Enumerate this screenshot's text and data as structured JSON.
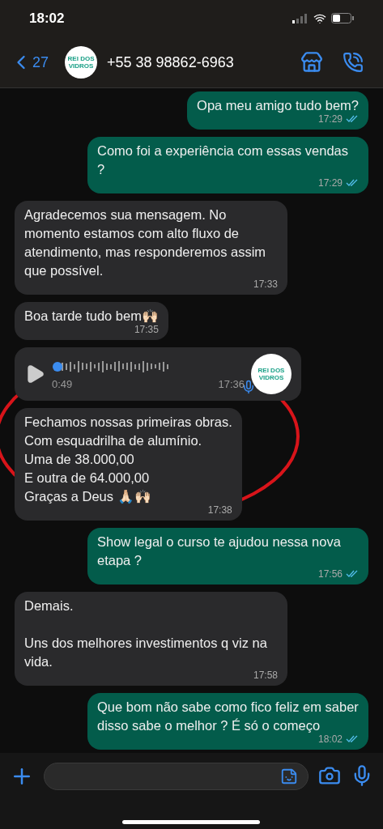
{
  "status_bar": {
    "time": "18:02"
  },
  "header": {
    "back_count": "27",
    "avatar_text": "REI DOS VIDROS",
    "title": "+55 38 98862-6963"
  },
  "messages": [
    {
      "kind": "text",
      "outgoing": true,
      "text": "Opa meu amigo tudo bem?",
      "time": "17:29",
      "read": true
    },
    {
      "kind": "text",
      "outgoing": true,
      "text": "Como foi a experiência com essas vendas ?",
      "time": "17:29",
      "read": true
    },
    {
      "kind": "text",
      "outgoing": false,
      "text": "Agradecemos sua mensagem. No momento estamos com alto fluxo de atendimento, mas responderemos assim que possível.",
      "time": "17:33"
    },
    {
      "kind": "text",
      "outgoing": false,
      "text": "Boa tarde tudo bem🙌🏻",
      "time": "17:35"
    },
    {
      "kind": "voice",
      "outgoing": false,
      "duration": "0:49",
      "time": "17:36",
      "avatar_text": "REI DOS VIDROS",
      "level": 0
    },
    {
      "kind": "text",
      "outgoing": false,
      "text": "Fechamos nossas primeiras obras.\nCom esquadrilha de alumínio.\nUma de 38.000,00\nE outra de 64.000,00\nGraças a Deus 🙏🏻🙌🏻",
      "time": "17:38"
    },
    {
      "kind": "text",
      "outgoing": true,
      "text": "Show legal o curso te ajudou nessa nova etapa ?",
      "time": "17:56",
      "read": true
    },
    {
      "kind": "text",
      "outgoing": false,
      "text": "Demais.\n\nUns dos melhores investimentos q viz na vida.",
      "time": "17:58"
    },
    {
      "kind": "text",
      "outgoing": true,
      "text": "Que bom não sabe como fico feliz em saber disso sabe o melhor ? É só o começo",
      "time": "18:02",
      "read": true
    }
  ]
}
